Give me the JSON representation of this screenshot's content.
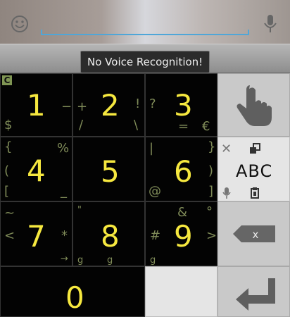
{
  "toast": {
    "message": "No Voice Recognition!"
  },
  "top": {
    "emoji_icon": "smile-icon",
    "mic_icon": "microphone-icon",
    "accent": "#4fa6d8"
  },
  "keys": [
    {
      "main": "1",
      "alt": [
        "−",
        "$"
      ],
      "badge": "C"
    },
    {
      "main": "2",
      "alt": [
        "+",
        "!",
        "/",
        "\\"
      ]
    },
    {
      "main": "3",
      "alt": [
        "?",
        "=",
        "€"
      ]
    },
    {
      "main": "4",
      "alt": [
        "{",
        "%",
        "(",
        "[",
        "_"
      ]
    },
    {
      "main": "5",
      "alt": []
    },
    {
      "main": "6",
      "alt": [
        "|",
        "}",
        ")",
        "@",
        "]"
      ]
    },
    {
      "main": "7",
      "alt": [
        "~",
        "<",
        "*",
        "→"
      ]
    },
    {
      "main": "8",
      "alt": [
        "\"",
        "g",
        "g"
      ]
    },
    {
      "main": "9",
      "alt": [
        "&",
        "#",
        "°",
        ">",
        "g"
      ]
    },
    {
      "main": "0",
      "alt": []
    }
  ],
  "side": {
    "swipe_icon": "hand-pointer-icon",
    "abc_label": "ABC",
    "x_label": "✕",
    "copy_icon": "copy-icon",
    "mic_icon": "microphone-icon",
    "paste_icon": "clipboard-icon",
    "delete_icon": "backspace-icon",
    "enter_icon": "enter-icon"
  },
  "colors": {
    "digit": "#f6e83f",
    "alt": "#7f8b58",
    "dark_key": "#030303",
    "gray_key": "#c9c9c9"
  }
}
